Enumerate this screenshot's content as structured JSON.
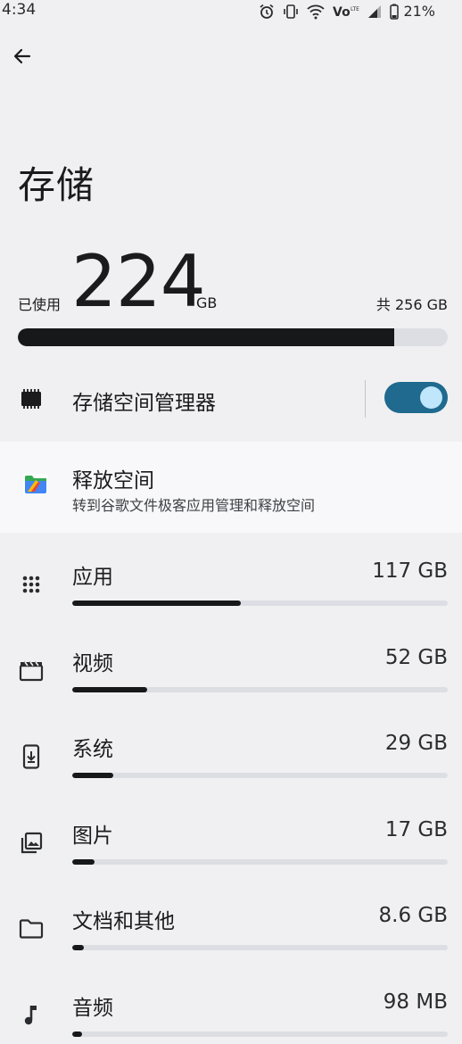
{
  "status_bar": {
    "time": "4:34",
    "battery": "21%"
  },
  "header": {
    "title": "存储"
  },
  "usage": {
    "used_label": "已使用",
    "used_value": "224",
    "used_unit": "GB",
    "total_label": "共 256 GB",
    "used_fraction": 0.875
  },
  "storage_manager": {
    "label": "存储空间管理器",
    "enabled": true
  },
  "free_space": {
    "title": "释放空间",
    "subtitle": "转到谷歌文件极客应用管理和释放空间"
  },
  "categories": [
    {
      "name": "apps",
      "icon": "apps-grid-icon",
      "label": "应用",
      "size": "117 GB",
      "fraction": 0.45
    },
    {
      "name": "videos",
      "icon": "video-icon",
      "label": "视频",
      "size": "52 GB",
      "fraction": 0.2
    },
    {
      "name": "system",
      "icon": "system-phone-icon",
      "label": "系统",
      "size": "29 GB",
      "fraction": 0.11
    },
    {
      "name": "images",
      "icon": "image-icon",
      "label": "图片",
      "size": "17 GB",
      "fraction": 0.06
    },
    {
      "name": "documents",
      "icon": "folder-icon",
      "label": "文档和其他",
      "size": "8.6 GB",
      "fraction": 0.03
    },
    {
      "name": "audio",
      "icon": "music-note-icon",
      "label": "音频",
      "size": "98 MB",
      "fraction": 0.001
    }
  ],
  "colors": {
    "background": "#f0f0f2",
    "bar_fill": "#17181a",
    "bar_track": "#dcdee3",
    "toggle_on": "#1f6a8e",
    "toggle_knob": "#bfe6fb"
  }
}
